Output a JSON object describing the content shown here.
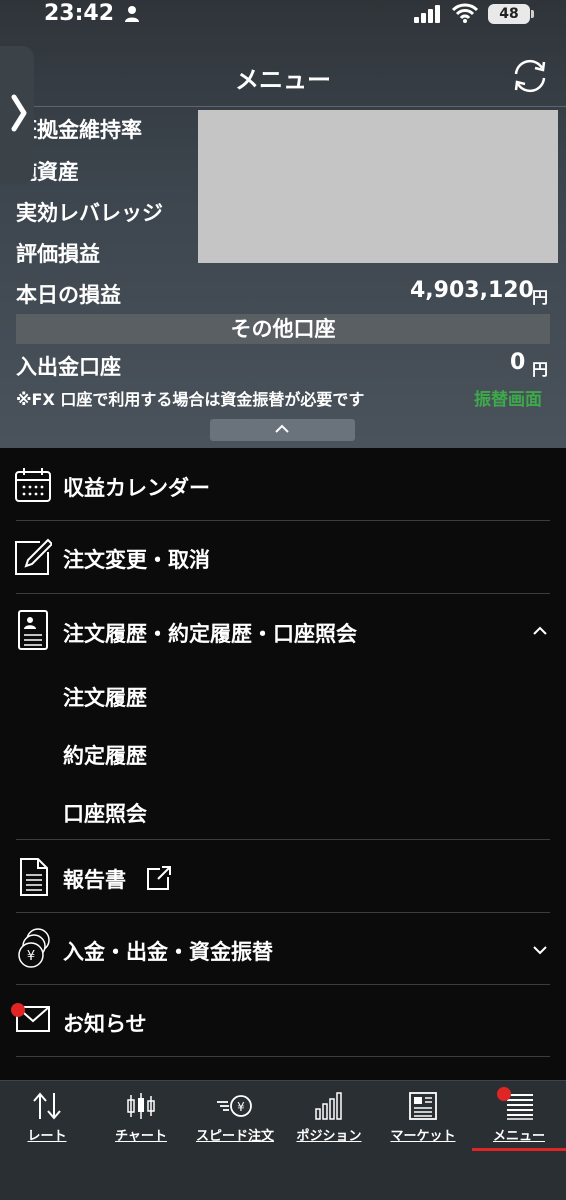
{
  "status_bar": {
    "time": "23:42",
    "battery": "48"
  },
  "header": {
    "title": "メニュー"
  },
  "account": {
    "rows": [
      {
        "label": "証拠金維持率"
      },
      {
        "label": "純資産"
      },
      {
        "label": "実効レバレッジ"
      },
      {
        "label": "評価損益"
      }
    ],
    "today_pl": {
      "label": "本日の損益",
      "value": "4,903,120",
      "unit": "円"
    },
    "other_accounts_header": "その他口座",
    "deposit_account": {
      "label": "入出金口座",
      "value": "0",
      "unit": "円"
    },
    "note": "※FX 口座で利用する場合は資金振替が必要です",
    "transfer_link": "振替画面"
  },
  "menu": {
    "calendar": "収益カレンダー",
    "order_change": "注文変更・取消",
    "history": "注文履歴・約定履歴・口座照会",
    "history_sub": [
      "注文履歴",
      "約定履歴",
      "口座照会"
    ],
    "report": "報告書",
    "funds": "入金・出金・資金振替",
    "news": "お知らせ"
  },
  "tabs": [
    {
      "label": "レート",
      "icon": "rate-arrows-icon"
    },
    {
      "label": "チャート",
      "icon": "candlestick-icon"
    },
    {
      "label": "スピード注文",
      "icon": "speed-order-icon"
    },
    {
      "label": "ポジション",
      "icon": "bar-chart-icon"
    },
    {
      "label": "マーケット",
      "icon": "newspaper-icon"
    },
    {
      "label": "メニュー",
      "icon": "list-icon"
    }
  ],
  "colors": {
    "accent_red": "#e02525",
    "link_green": "#3da94a",
    "panel_bg": "#3c454d",
    "menu_bg": "#0b0b0b"
  }
}
